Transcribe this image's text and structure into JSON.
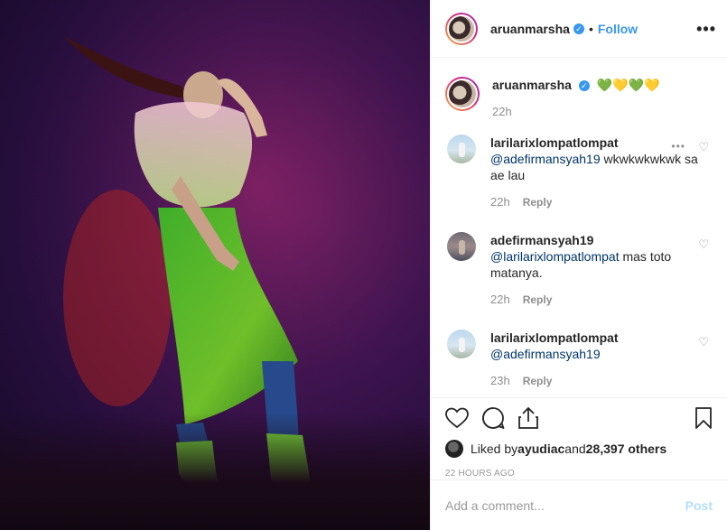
{
  "header": {
    "username": "aruanmarsha",
    "dot": "•",
    "follow_label": "Follow",
    "more_label": "•••"
  },
  "caption": {
    "username": "aruanmarsha",
    "text": "💚💛💚💛",
    "time": "22h"
  },
  "comments": [
    {
      "username": "larilarixlompatlompat",
      "mention": "@adefirmansyah19",
      "text": " wkwkwkwkwk sa ae lau",
      "time": "22h",
      "reply_label": "Reply",
      "show_more": true
    },
    {
      "username": "adefirmansyah19",
      "mention": "@larilarixlompatlompat",
      "text": " mas toto matanya.",
      "time": "22h",
      "reply_label": "Reply",
      "show_more": false
    },
    {
      "username": "larilarixlompatlompat",
      "mention": "@adefirmansyah19",
      "text": "",
      "time": "23h",
      "reply_label": "Reply",
      "show_more": false
    }
  ],
  "likes": {
    "prefix": "Liked by ",
    "user": "ayudiac",
    "middle": " and ",
    "count": "28,397 others"
  },
  "timestamp": "22 HOURS AGO",
  "add_comment": {
    "placeholder": "Add a comment...",
    "post_label": "Post"
  },
  "colors": {
    "accent": "#3897f0",
    "post_disabled": "#b2dffc",
    "mention": "#003569"
  },
  "icons": [
    "verified-badge-icon",
    "heart-icon",
    "comment-icon",
    "share-icon",
    "bookmark-icon",
    "more-options-icon"
  ]
}
